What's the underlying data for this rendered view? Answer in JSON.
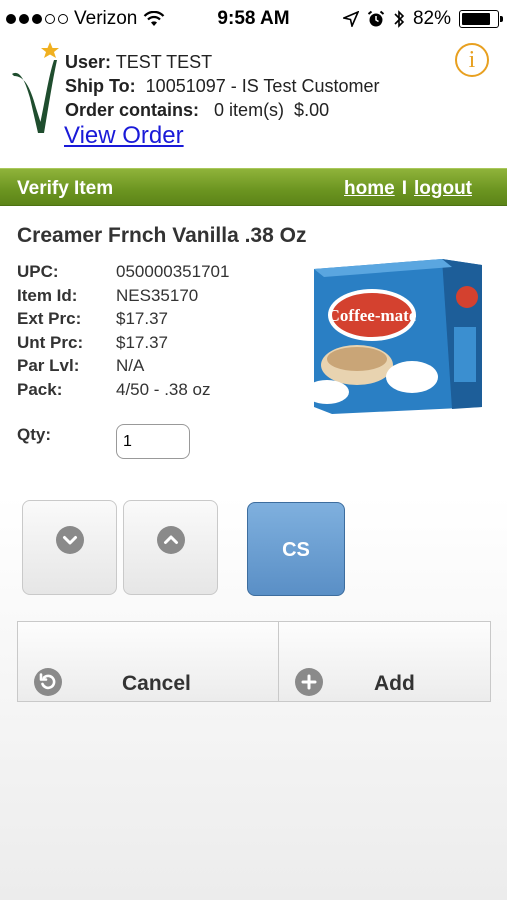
{
  "status_bar": {
    "carrier": "Verizon",
    "time": "9:58 AM",
    "battery": "82%",
    "battery_level": 0.82
  },
  "header": {
    "user_label": "User:",
    "user_value": "TEST TEST",
    "ship_label": "Ship To:",
    "ship_value": "10051097 - IS Test Customer",
    "order_label": "Order contains:",
    "order_value": "0 item(s)  $.00",
    "view_order": "View Order",
    "info_glyph": "i"
  },
  "nav": {
    "title": "Verify Item",
    "home": "home",
    "separator": "I",
    "logout": "logout"
  },
  "item": {
    "title": "Creamer Frnch Vanilla .38 Oz",
    "details": [
      {
        "label": "UPC:",
        "value": "050000351701"
      },
      {
        "label": "Item Id:",
        "value": "NES35170"
      },
      {
        "label": "Ext Prc:",
        "value": "$17.37"
      },
      {
        "label": "Unt Prc:",
        "value": "$17.37"
      },
      {
        "label": "Par Lvl:",
        "value": "N/A"
      },
      {
        "label": "Pack:",
        "value": "4/50 - .38 oz"
      }
    ],
    "image_text": "Coffee-mate",
    "qty_label": "Qty:",
    "qty_value": "1"
  },
  "controls": {
    "unit_label": "CS"
  },
  "actions": {
    "cancel": "Cancel",
    "add": "Add"
  },
  "colors": {
    "nav_green": "#6b9420",
    "link_blue": "#1a1ad8",
    "unit_blue": "#5a8fc6",
    "info_orange": "#e8a020"
  }
}
